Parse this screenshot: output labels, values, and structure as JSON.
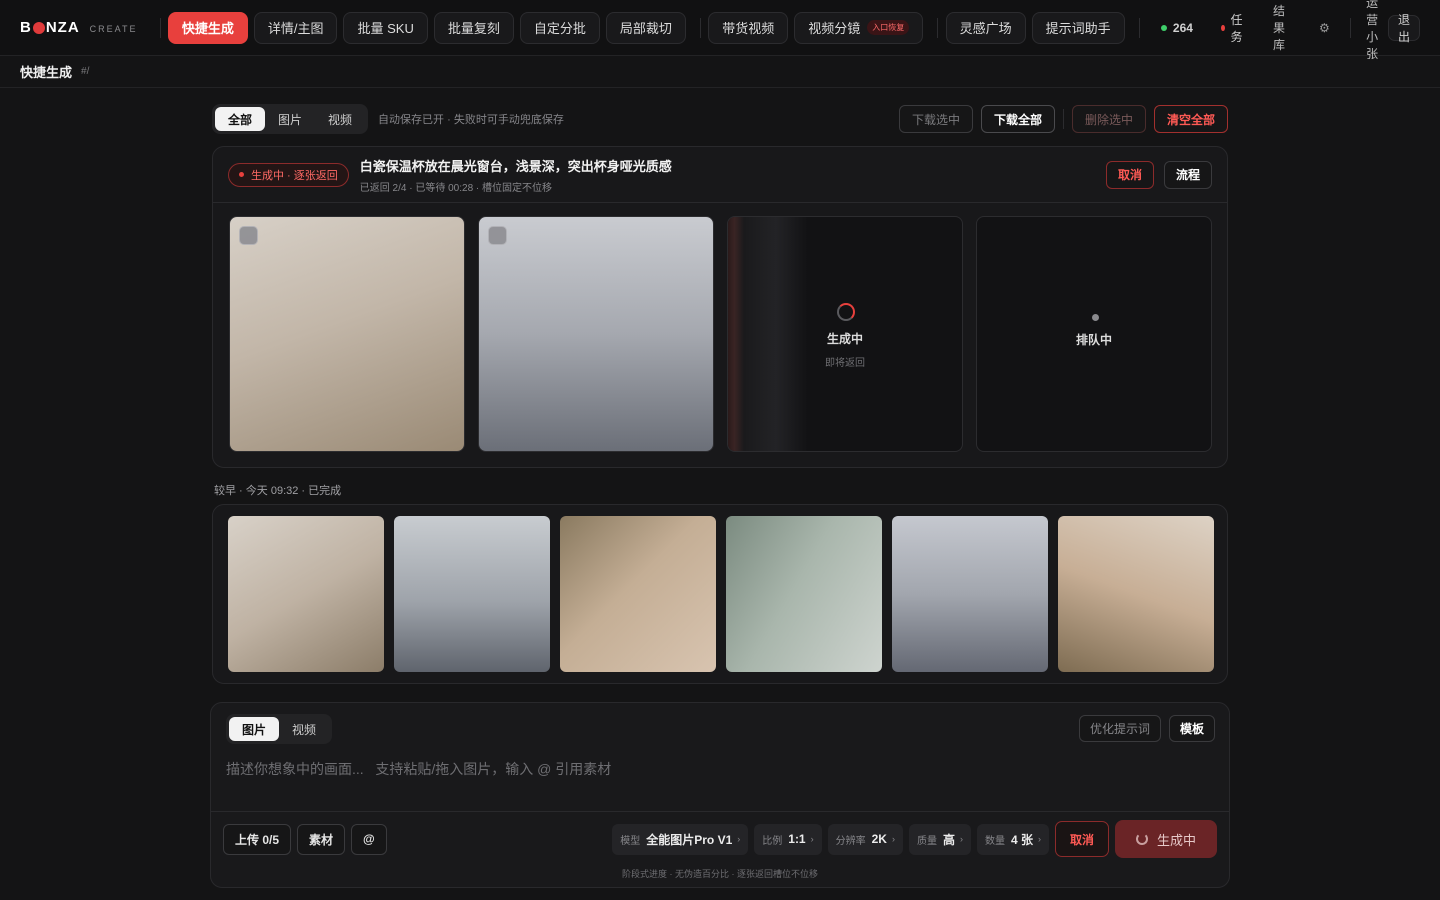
{
  "brand": {
    "name_pre": "B",
    "name_post": "NZA",
    "sub": "CREATE"
  },
  "nav": {
    "items": [
      {
        "label": "快捷生成"
      },
      {
        "label": "详情/主图"
      },
      {
        "label": "批量 SKU"
      },
      {
        "label": "批量复刻"
      },
      {
        "label": "自定分批"
      },
      {
        "label": "局部裁切"
      },
      {
        "label": "带货视频"
      },
      {
        "label": "视频分镜",
        "badge": "入口恢复"
      },
      {
        "label": "灵感广场"
      },
      {
        "label": "提示词助手"
      }
    ],
    "credits": "264",
    "tasks": "任务",
    "results": "结果库",
    "settings_icon": "gear-icon",
    "user": "运营小张",
    "logout": "退出"
  },
  "breadcrumb": {
    "title": "快捷生成",
    "hash": "#/"
  },
  "toolbar": {
    "filters": [
      "全部",
      "图片",
      "视频"
    ],
    "hint": "自动保存已开 · 失败时可手动兜底保存",
    "download_selected": "下载选中",
    "download_all": "下载全部",
    "delete_selected": "删除选中",
    "clear_all": "清空全部"
  },
  "current_task": {
    "status": "生成中 · 逐张返回",
    "title": "白瓷保温杯放在晨光窗台，浅景深，突出杯身哑光质感",
    "meta": "已返回 2/4 · 已等待 00:28 · 槽位固定不位移",
    "cancel": "取消",
    "flow": "流程",
    "tiles": [
      {
        "state": "done",
        "tone": "beige"
      },
      {
        "state": "done",
        "tone": "gray"
      },
      {
        "state": "generating",
        "label": "生成中",
        "sub": "即将返回"
      },
      {
        "state": "queued",
        "label": "排队中"
      }
    ]
  },
  "earlier": {
    "label": "较早 · 今天 09:32 · 已完成",
    "thumbs": [
      "beige",
      "gray",
      "tan",
      "sage",
      "silver",
      "sand"
    ]
  },
  "composer": {
    "modes": [
      "图片",
      "视频"
    ],
    "optimize": "优化提示词",
    "template": "模板",
    "placeholder": "描述你想象中的画面...   支持粘贴/拖入图片，输入 @ 引用素材",
    "upload": "上传 0/5",
    "assets": "素材",
    "mention": "@",
    "params": [
      {
        "label": "模型",
        "value": "全能图片Pro V1"
      },
      {
        "label": "比例",
        "value": "1:1"
      },
      {
        "label": "分辨率",
        "value": "2K"
      },
      {
        "label": "质量",
        "value": "高"
      },
      {
        "label": "数量",
        "value": "4 张"
      }
    ],
    "cancel": "取消",
    "generate": "生成中",
    "footnote": "阶段式进度  ·  无伪造百分比  ·  逐张返回槽位不位移"
  }
}
